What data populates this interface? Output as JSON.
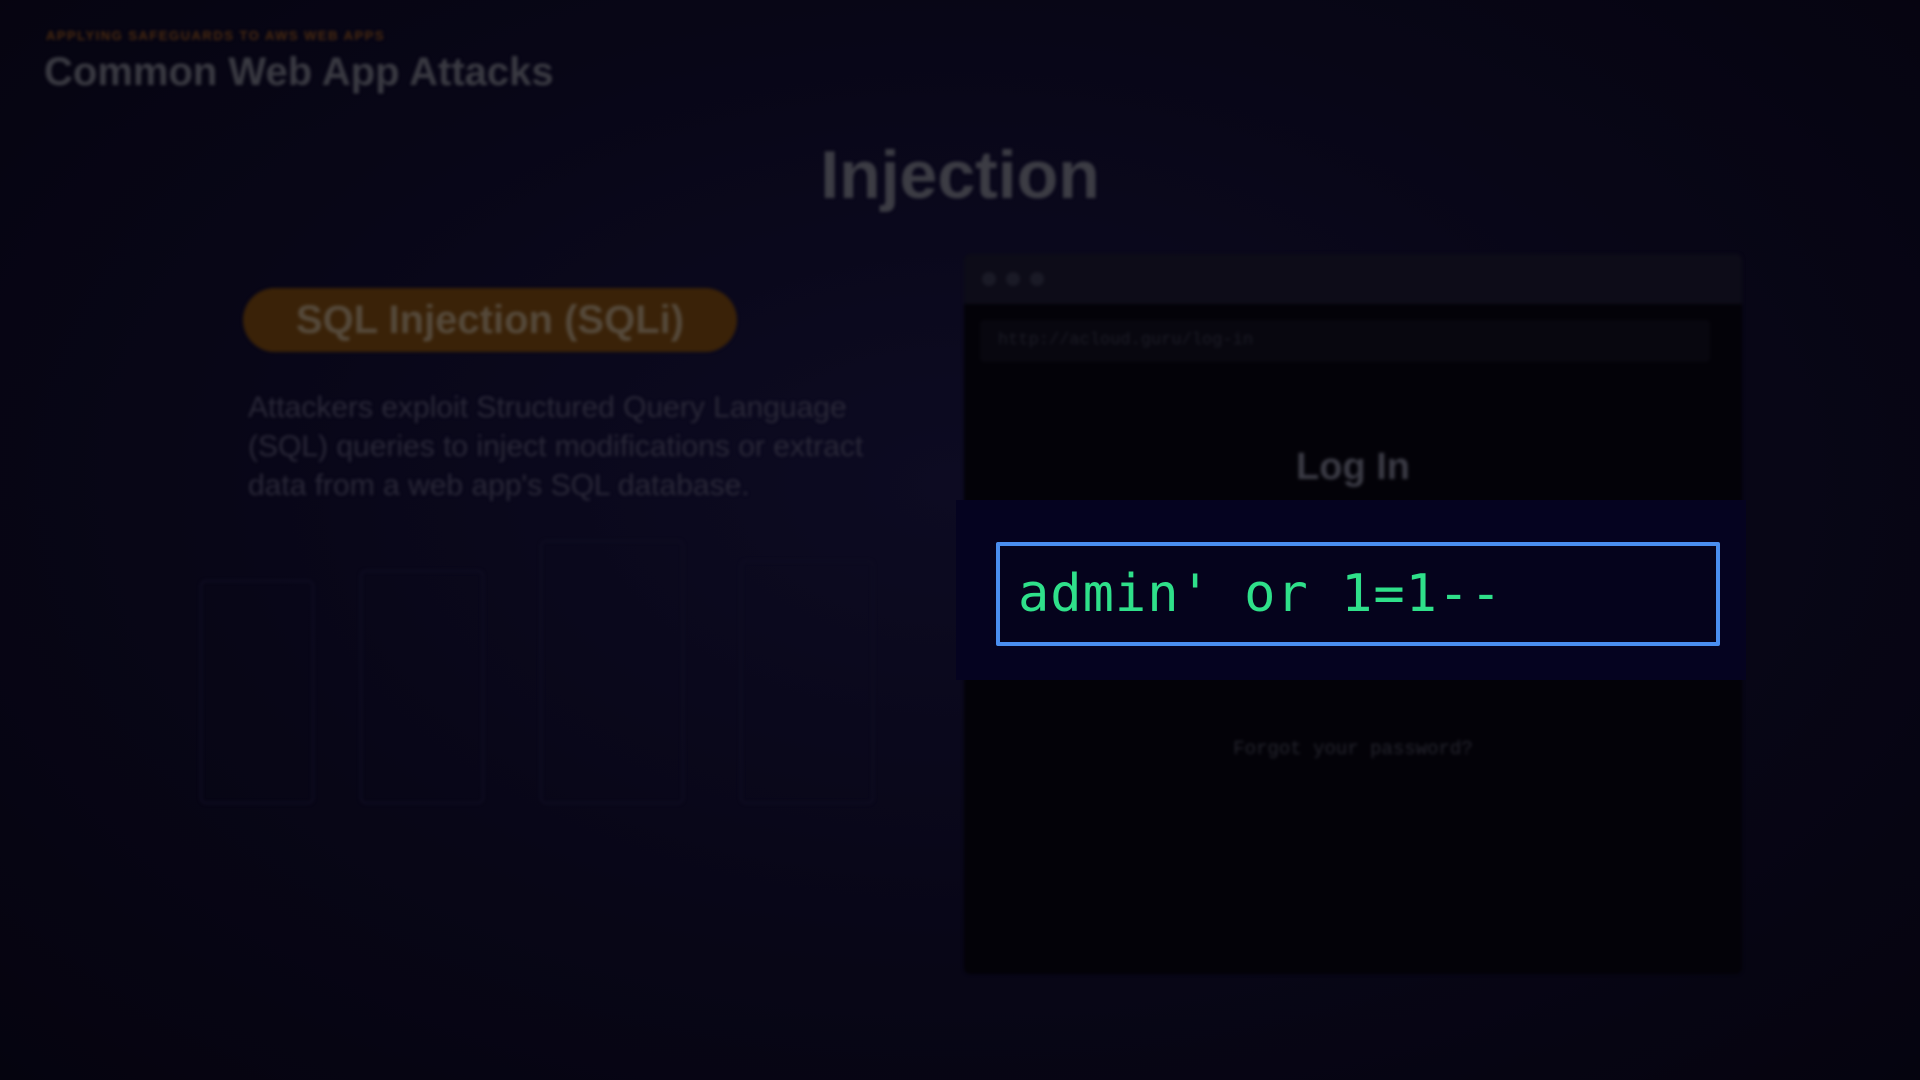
{
  "slide": {
    "kicker": "APPLYING SAFEGUARDS TO AWS WEB APPS",
    "title": "Common Web App Attacks",
    "heading": "Injection",
    "pill_label": "SQL Injection (SQLi)",
    "description": "Attackers exploit Structured Query Language (SQL) queries to inject modifications or extract data from a web app's SQL database."
  },
  "browser": {
    "url": "http://acloud.guru/log-in",
    "login_heading": "Log In",
    "input_value": "admin' or 1=1--",
    "forgot_link": "Forgot your password?"
  },
  "colors": {
    "accent_orange": "#3a2208",
    "input_border": "#4a8ef0",
    "input_text": "#2fe08a"
  }
}
